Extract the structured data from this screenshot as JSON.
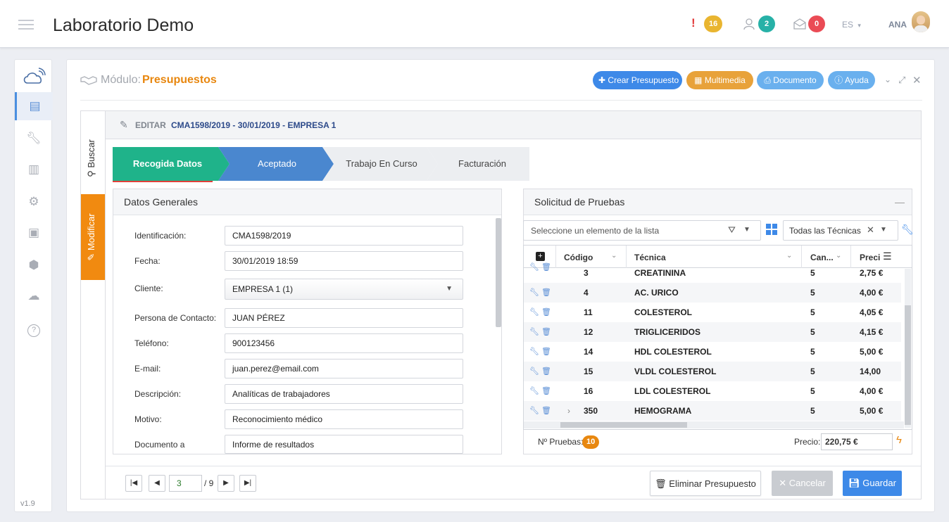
{
  "app": {
    "title": "Laboratorio Demo",
    "version": "v1.9"
  },
  "topbar": {
    "alerts_count": "16",
    "users_count": "2",
    "messages_count": "0",
    "language": "ES",
    "user_name": "ANA",
    "colors": {
      "alerts": "#e9b530",
      "users": "#27b1a7",
      "messages": "#ea4b55"
    }
  },
  "sidebar": {
    "items": [
      {
        "icon": "cloud-icon"
      },
      {
        "icon": "newspaper-icon",
        "active": true
      },
      {
        "icon": "wrench-icon"
      },
      {
        "icon": "bar-chart-icon"
      },
      {
        "icon": "gear-icon"
      },
      {
        "icon": "calendar-check-icon"
      },
      {
        "icon": "cube-icon"
      },
      {
        "icon": "cloud-solid-icon"
      },
      {
        "icon": "help-circle-icon"
      }
    ]
  },
  "module": {
    "prefix": "Módulo:",
    "name": "Presupuestos",
    "buttons": {
      "create": "Crear Presupuesto",
      "multimedia": "Multimedia",
      "document": "Documento",
      "help": "Ayuda"
    }
  },
  "side_tabs": {
    "search": "Buscar",
    "modify": "Modificar"
  },
  "edit_header": {
    "label": "EDITAR",
    "record": "CMA1598/2019 - 30/01/2019 - EMPRESA 1"
  },
  "steps": [
    "Recogida Datos",
    "Aceptado",
    "Trabajo En Curso",
    "Facturación"
  ],
  "general": {
    "title": "Datos Generales",
    "fields": [
      {
        "label": "Identificación:",
        "value": "CMA1598/2019"
      },
      {
        "label": "Fecha:",
        "value": "30/01/2019 18:59"
      },
      {
        "label": "Cliente:",
        "value": "EMPRESA 1 (1)"
      },
      {
        "label": "Persona de Contacto:",
        "value": "JUAN PÉREZ"
      },
      {
        "label": "Teléfono:",
        "value": "900123456"
      },
      {
        "label": "E-mail:",
        "value": "juan.perez@email.com"
      },
      {
        "label": "Descripción:",
        "value": "Analíticas de trabajadores"
      },
      {
        "label": "Motivo:",
        "value": "Reconocimiento médico"
      },
      {
        "label": "Documento a",
        "value": "Informe de resultados"
      }
    ]
  },
  "tests": {
    "title": "Solicitud de Pruebas",
    "select_placeholder": "Seleccione un elemento de la lista",
    "technique_filter": "Todas las Técnicas",
    "columns": [
      "Código",
      "Técnica",
      "Can...",
      "Preci"
    ],
    "rows": [
      {
        "code": "3",
        "name": "CREATININA",
        "qty": "5",
        "price": "2,75 €"
      },
      {
        "code": "4",
        "name": "AC. URICO",
        "qty": "5",
        "price": "4,00 €"
      },
      {
        "code": "11",
        "name": "COLESTEROL",
        "qty": "5",
        "price": "4,05 €"
      },
      {
        "code": "12",
        "name": "TRIGLICERIDOS",
        "qty": "5",
        "price": "4,15 €"
      },
      {
        "code": "14",
        "name": "HDL COLESTEROL",
        "qty": "5",
        "price": "5,00 €"
      },
      {
        "code": "15",
        "name": "VLDL COLESTEROL",
        "qty": "5",
        "price": "14,00"
      },
      {
        "code": "16",
        "name": "LDL COLESTEROL",
        "qty": "5",
        "price": "4,00 €"
      },
      {
        "code": "350",
        "name": "HEMOGRAMA",
        "qty": "5",
        "price": "5,00 €"
      }
    ],
    "count_label": "Nº Pruebas:",
    "count": "10",
    "price_label": "Precio:",
    "price": "220,75 €"
  },
  "pager": {
    "current": "3",
    "total": "/ 9"
  },
  "actions": {
    "delete": "Eliminar Presupuesto",
    "cancel": "Cancelar",
    "save": "Guardar"
  }
}
